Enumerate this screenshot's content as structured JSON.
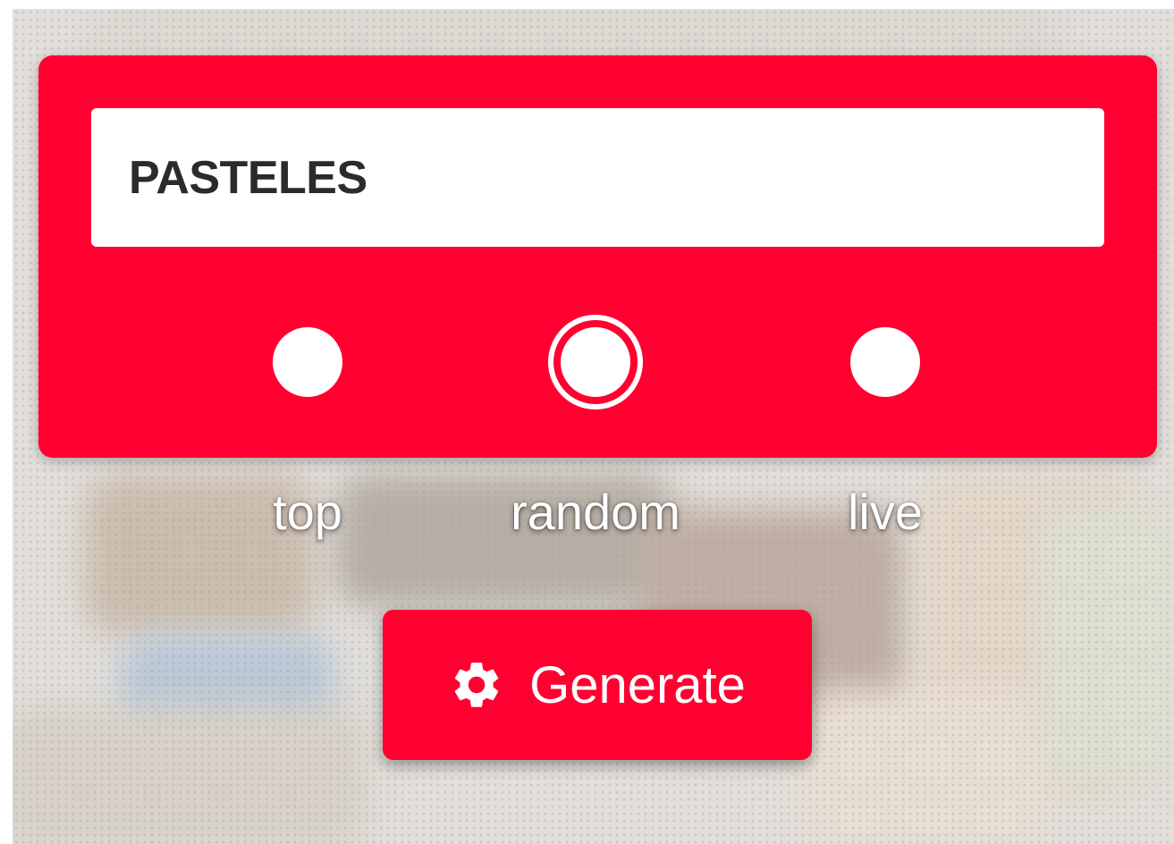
{
  "search": {
    "value": "PASTELES"
  },
  "options": [
    {
      "label": "top",
      "selected": false
    },
    {
      "label": "random",
      "selected": true
    },
    {
      "label": "live",
      "selected": false
    }
  ],
  "generate": {
    "label": "Generate",
    "icon": "gear-icon"
  },
  "colors": {
    "accent": "#ff0030",
    "field": "#ffffff",
    "text": "#2b2b2b"
  }
}
